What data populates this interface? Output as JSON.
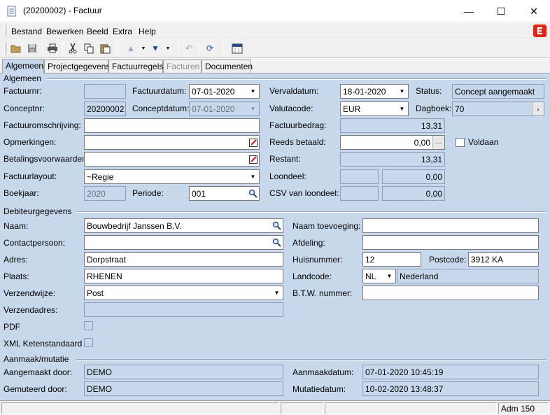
{
  "window": {
    "title": "(20200002) - Factuur",
    "minimize": "—",
    "maximize": "☐",
    "close": "✕"
  },
  "menu": {
    "items": [
      "Bestand",
      "Bewerken",
      "Beeld",
      "Extra",
      "Help"
    ],
    "accent_color": "#e2231a"
  },
  "tabs": [
    "Algemeen",
    "Projectgegevens",
    "Factuurregels",
    "Facturen",
    "Documenten"
  ],
  "algemeen": {
    "section": "Algemeen",
    "factuurnr_label": "Factuurnr:",
    "factuurnr_value": "",
    "conceptnr_label": "Conceptnr:",
    "conceptnr_value": "20200002",
    "factuurdatum_label": "Factuurdatum:",
    "factuurdatum_value": "07-01-2020",
    "conceptdatum_label": "Conceptdatum:",
    "conceptdatum_value": "07-01-2020",
    "vervaldatum_label": "Vervaldatum:",
    "vervaldatum_value": "18-01-2020",
    "valutacode_label": "Valutacode:",
    "valutacode_value": "EUR",
    "status_label": "Status:",
    "status_value": "Concept aangemaakt",
    "dagboek_label": "Dagboek:",
    "dagboek_value": "70",
    "omschrijving_label": "Factuuromschrijving:",
    "omschrijving_value": "",
    "opmerkingen_label": "Opmerkingen:",
    "opmerkingen_value": "",
    "betalingsvoorwaarden_label": "Betalingsvoorwaarden:",
    "betalingsvoorwaarden_value": "",
    "factuurlayout_label": "Factuurlayout:",
    "factuurlayout_value": "~Regie",
    "boekjaar_label": "Boekjaar:",
    "boekjaar_value": "2020",
    "periode_label": "Periode:",
    "periode_value": "001",
    "factuurbedrag_label": "Factuurbedrag:",
    "factuurbedrag_value": "13,31",
    "reeds_betaald_label": "Reeds betaald:",
    "reeds_betaald_value": "0,00",
    "voldaan_label": "Voldaan",
    "restant_label": "Restant:",
    "restant_value": "13,31",
    "loondeel_label": "Loondeel:",
    "loondeel_value": "0,00",
    "csv_label": "CSV van loondeel:",
    "csv_value": "0,00"
  },
  "debiteur": {
    "section": "Debiteurgegevens",
    "naam_label": "Naam:",
    "naam_value": "Bouwbedrijf Janssen  B.V.",
    "contactpersoon_label": "Contactpersoon:",
    "contactpersoon_value": "",
    "adres_label": "Adres:",
    "adres_value": "Dorpstraat",
    "plaats_label": "Plaats:",
    "plaats_value": "RHENEN",
    "verzendwijze_label": "Verzendwijze:",
    "verzendwijze_value": "Post",
    "verzendadres_label": "Verzendadres:",
    "verzendadres_value": "",
    "pdf_label": "PDF",
    "xml_label": "XML Ketenstandaard",
    "naam_toevoeging_label": "Naam toevoeging:",
    "naam_toevoeging_value": "",
    "afdeling_label": "Afdeling:",
    "afdeling_value": "",
    "huisnummer_label": "Huisnummer:",
    "huisnummer_value": "12",
    "postcode_label": "Postcode:",
    "postcode_value": "3912 KA",
    "landcode_label": "Landcode:",
    "landcode_value": "NL",
    "land_value": "Nederland",
    "btw_label": "B.T.W. nummer:",
    "btw_value": ""
  },
  "mutatie": {
    "section": "Aanmaak/mutatie",
    "aangemaakt_label": "Aangemaakt door:",
    "aangemaakt_value": "DEMO",
    "gemuteerd_label": "Gemuteerd door:",
    "gemuteerd_value": "DEMO",
    "aanmaakdatum_label": "Aanmaakdatum:",
    "aanmaakdatum_value": "07-01-2020 10:45:19",
    "mutatiedatum_label": "Mutatiedatum:",
    "mutatiedatum_value": "10-02-2020 13:48:37"
  },
  "statusbar": {
    "user": "Adm 150"
  }
}
